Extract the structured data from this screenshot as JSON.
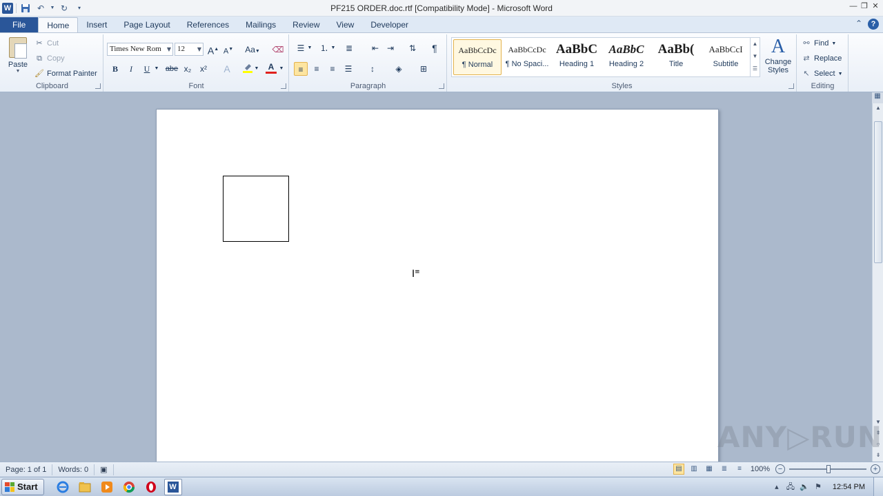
{
  "window": {
    "title": "PF215 ORDER.doc.rtf [Compatibility Mode]  -  Microsoft Word"
  },
  "qat": {
    "app_icon": "W"
  },
  "tabs": [
    {
      "label": "File"
    },
    {
      "label": "Home"
    },
    {
      "label": "Insert"
    },
    {
      "label": "Page Layout"
    },
    {
      "label": "References"
    },
    {
      "label": "Mailings"
    },
    {
      "label": "Review"
    },
    {
      "label": "View"
    },
    {
      "label": "Developer"
    }
  ],
  "clipboard": {
    "group_label": "Clipboard",
    "paste": "Paste",
    "cut": "Cut",
    "copy": "Copy",
    "format_painter": "Format Painter"
  },
  "font": {
    "group_label": "Font",
    "family": "Times New Rom",
    "size": "12",
    "grow": "A",
    "shrink": "A",
    "case": "Aa",
    "bold": "B",
    "italic": "I",
    "underline": "U",
    "strike": "abe",
    "subscript": "x₂",
    "superscript": "x²",
    "effects": "A",
    "color": "A",
    "highlight_color": "#ffff00",
    "font_color": "#e0201c"
  },
  "paragraph": {
    "group_label": "Paragraph",
    "show_marks": "¶"
  },
  "styles": {
    "group_label": "Styles",
    "items": [
      {
        "preview": "AaBbCcDc",
        "name": "¶ Normal"
      },
      {
        "preview": "AaBbCcDc",
        "name": "¶ No Spaci..."
      },
      {
        "preview": "AaBbC",
        "name": "Heading 1"
      },
      {
        "preview": "AaBbC",
        "name": "Heading 2"
      },
      {
        "preview": "AaBb(",
        "name": "Title"
      },
      {
        "preview": "AaBbCcI",
        "name": "Subtitle"
      }
    ],
    "change_styles": "Change Styles"
  },
  "editing": {
    "group_label": "Editing",
    "find": "Find",
    "replace": "Replace",
    "select": "Select"
  },
  "statusbar": {
    "page": "Page: 1 of 1",
    "words": "Words: 0",
    "zoom": "100%"
  },
  "taskbar": {
    "start": "Start",
    "clock": "12:54 PM"
  },
  "watermark": "ANY▷RUN"
}
